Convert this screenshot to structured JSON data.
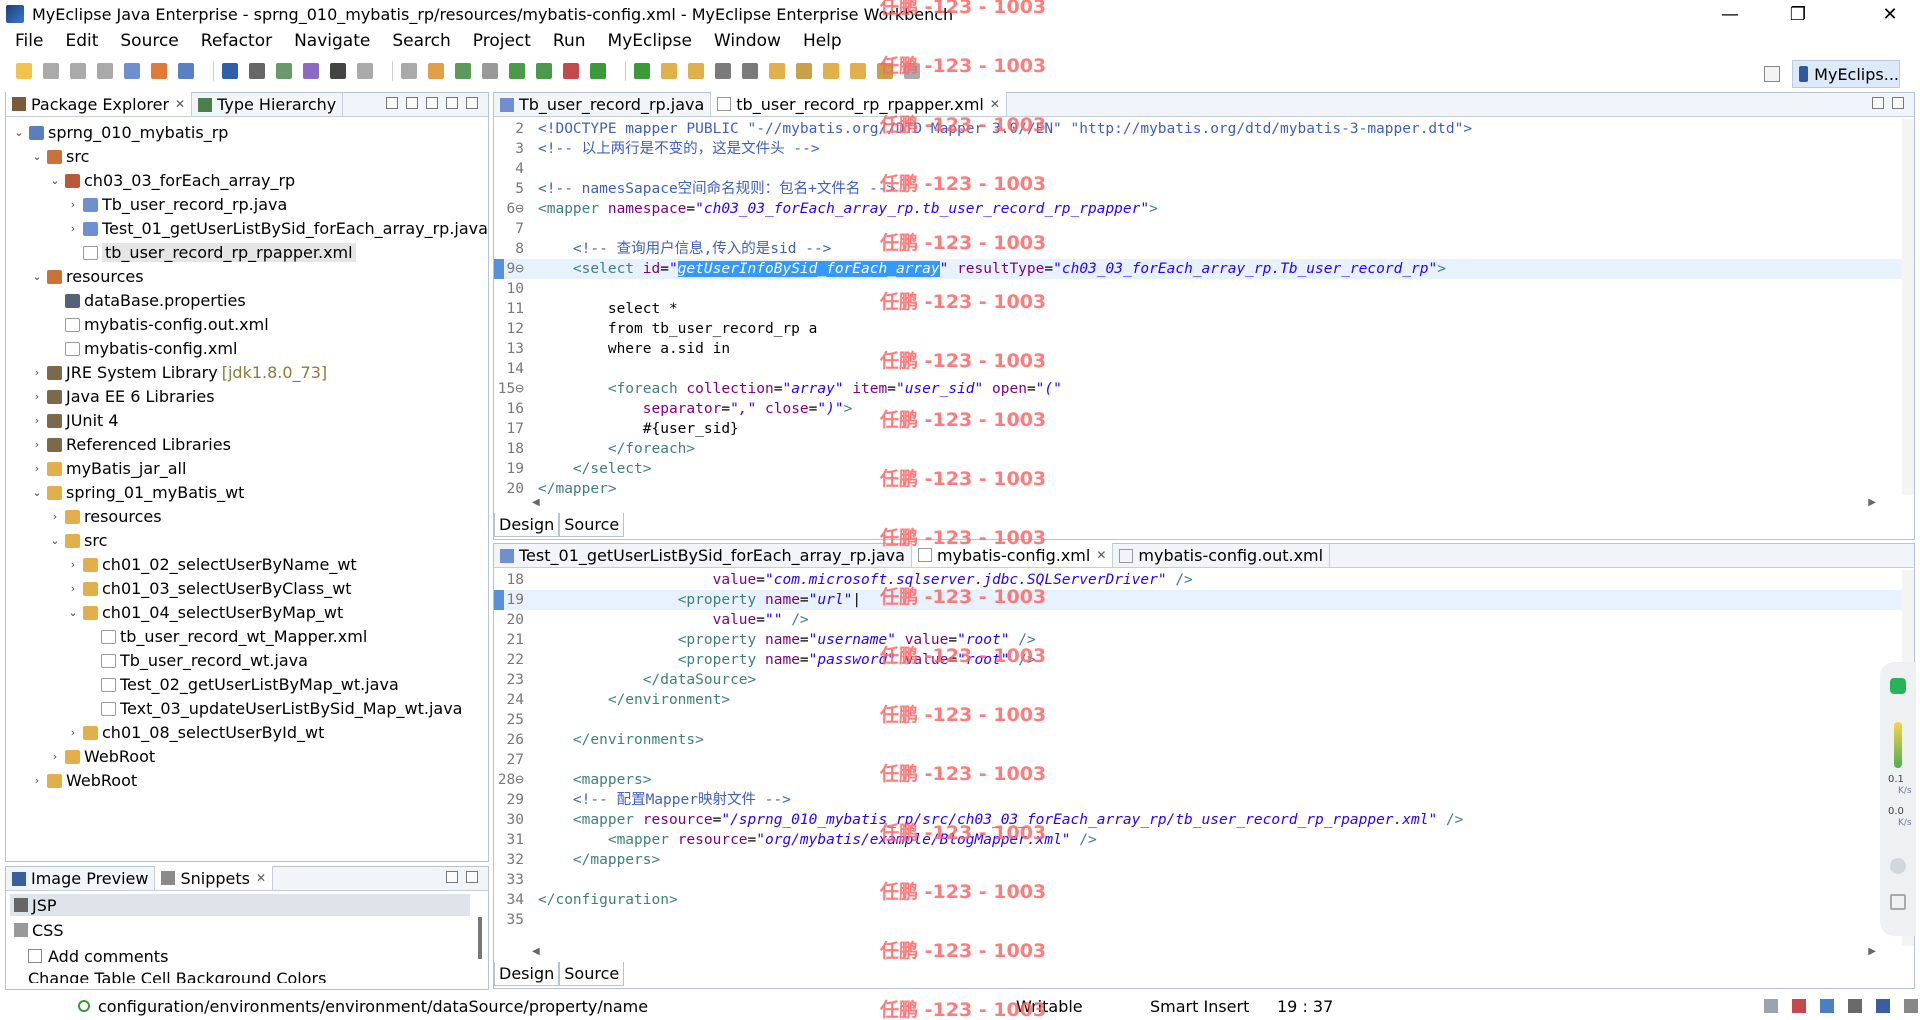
{
  "window": {
    "title": "MyEclipse Java Enterprise - sprng_010_mybatis_rp/resources/mybatis-config.xml - MyEclipse Enterprise Workbench",
    "controls": [
      "—",
      "❐",
      "✕"
    ]
  },
  "menu": [
    "File",
    "Edit",
    "Source",
    "Refactor",
    "Navigate",
    "Search",
    "Project",
    "Run",
    "MyEclipse",
    "Window",
    "Help"
  ],
  "perspective": {
    "label": "MyEclips..."
  },
  "explorer": {
    "tabs": [
      "Package Explorer",
      "Type Hierarchy"
    ],
    "tree": [
      {
        "label": "sprng_010_mybatis_rp",
        "level": 0,
        "arrow": "v",
        "icon": "project",
        "color": "#5b7fb8"
      },
      {
        "label": "src",
        "level": 1,
        "arrow": "v",
        "icon": "srcfolder",
        "color": "#c9733a"
      },
      {
        "label": "ch03_03_forEach_array_rp",
        "level": 2,
        "arrow": "v",
        "icon": "package",
        "color": "#b85a3a"
      },
      {
        "label": "Tb_user_record_rp.java",
        "level": 3,
        "arrow": ">",
        "icon": "java",
        "color": "#6f8fcf"
      },
      {
        "label": "Test_01_getUserListBySid_forEach_array_rp.java",
        "level": 3,
        "arrow": ">",
        "icon": "java",
        "color": "#6f8fcf"
      },
      {
        "label": "tb_user_record_rp_rpapper.xml",
        "level": 3,
        "arrow": "",
        "icon": "xml",
        "color": "#9a9a9a",
        "selected": true
      },
      {
        "label": "resources",
        "level": 1,
        "arrow": "v",
        "icon": "srcfolder",
        "color": "#c9733a"
      },
      {
        "label": "dataBase.properties",
        "level": 2,
        "arrow": "",
        "icon": "props",
        "color": "#55607a"
      },
      {
        "label": "mybatis-config.out.xml",
        "level": 2,
        "arrow": "",
        "icon": "xml",
        "color": "#9a9a9a"
      },
      {
        "label": "mybatis-config.xml",
        "level": 2,
        "arrow": "",
        "icon": "xml",
        "color": "#9a9a9a"
      },
      {
        "label": "JRE System Library",
        "decoration": "[jdk1.8.0_73]",
        "level": 1,
        "arrow": ">",
        "icon": "lib",
        "color": "#7a6a4a"
      },
      {
        "label": "Java EE 6 Libraries",
        "level": 1,
        "arrow": ">",
        "icon": "lib",
        "color": "#7a6a4a"
      },
      {
        "label": "JUnit 4",
        "level": 1,
        "arrow": ">",
        "icon": "lib",
        "color": "#7a6a4a"
      },
      {
        "label": "Referenced Libraries",
        "level": 1,
        "arrow": ">",
        "icon": "lib",
        "color": "#7a6a4a"
      },
      {
        "label": "myBatis_jar_all",
        "level": 1,
        "arrow": ">",
        "icon": "folder",
        "color": "#e2b04a"
      },
      {
        "label": "spring_01_myBatis_wt",
        "level": 1,
        "arrow": "v",
        "icon": "folder",
        "color": "#e2b04a"
      },
      {
        "label": "resources",
        "level": 2,
        "arrow": ">",
        "icon": "folder",
        "color": "#e2b04a"
      },
      {
        "label": "src",
        "level": 2,
        "arrow": "v",
        "icon": "folder",
        "color": "#e2b04a"
      },
      {
        "label": "ch01_02_selectUserByName_wt",
        "level": 3,
        "arrow": ">",
        "icon": "folder",
        "color": "#e2b04a"
      },
      {
        "label": "ch01_03_selectUserByClass_wt",
        "level": 3,
        "arrow": ">",
        "icon": "folder",
        "color": "#e2b04a"
      },
      {
        "label": "ch01_04_selectUserByMap_wt",
        "level": 3,
        "arrow": "v",
        "icon": "folder",
        "color": "#e2b04a"
      },
      {
        "label": "tb_user_record_wt_Mapper.xml",
        "level": 4,
        "arrow": "",
        "icon": "xml",
        "color": "#9a9a9a"
      },
      {
        "label": "Tb_user_record_wt.java",
        "level": 4,
        "arrow": "",
        "icon": "file",
        "color": "#9a9a9a"
      },
      {
        "label": "Test_02_getUserListByMap_wt.java",
        "level": 4,
        "arrow": "",
        "icon": "file",
        "color": "#9a9a9a"
      },
      {
        "label": "Text_03_updateUserListBySid_Map_wt.java",
        "level": 4,
        "arrow": "",
        "icon": "file",
        "color": "#9a9a9a"
      },
      {
        "label": "ch01_08_selectUserById_wt",
        "level": 3,
        "arrow": ">",
        "icon": "folder",
        "color": "#e2b04a"
      },
      {
        "label": "WebRoot",
        "level": 2,
        "arrow": ">",
        "icon": "folder",
        "color": "#e2b04a"
      },
      {
        "label": "WebRoot",
        "level": 1,
        "arrow": ">",
        "icon": "folder",
        "color": "#e2b04a"
      }
    ]
  },
  "snippets": {
    "tabs": [
      "Image Preview",
      "Snippets"
    ],
    "categories": [
      "JSP",
      "CSS"
    ],
    "items": [
      "Add comments",
      "Change Table Cell Background Colors"
    ]
  },
  "editor_top": {
    "tabs": [
      "Tb_user_record_rp.java",
      "tb_user_record_rp_rpapper.xml"
    ],
    "active_tab": 1,
    "bottom_tabs": [
      "Design",
      "Source"
    ],
    "lines": [
      {
        "n": "2",
        "segs": [
          [
            "cm",
            "<!DOCTYPE mapper PUBLIC \"-//mybatis.org//DTD Mapper 3.0//EN\" \"http://mybatis.org/dtd/mybatis-3-mapper.dtd\">"
          ]
        ]
      },
      {
        "n": "3",
        "segs": [
          [
            "cm",
            "<!-- 以上两行是不变的，这是文件头 -->"
          ]
        ]
      },
      {
        "n": "4",
        "segs": []
      },
      {
        "n": "5",
        "segs": [
          [
            "cm",
            "<!-- namesSapace空间命名规则：包名+文件名 -->"
          ]
        ]
      },
      {
        "n": "6⊖",
        "segs": [
          [
            "tag",
            "<mapper "
          ],
          [
            "attr",
            "namespace"
          ],
          [
            "plain",
            "="
          ],
          [
            "val",
            "\"ch03_03_forEach_array_rp.tb_user_record_rp_rpapper\""
          ],
          [
            "tag",
            ">"
          ]
        ]
      },
      {
        "n": "7",
        "segs": []
      },
      {
        "n": "8",
        "segs": [
          [
            "plain",
            "    "
          ],
          [
            "cm",
            "<!-- 查询用户信息,传入的是sid -->"
          ]
        ]
      },
      {
        "n": "9⊖",
        "cur": true,
        "segs": [
          [
            "plain",
            "    "
          ],
          [
            "tag",
            "<select "
          ],
          [
            "attr",
            "id"
          ],
          [
            "plain",
            "="
          ],
          [
            "val",
            "\""
          ],
          [
            "hl",
            "getUserInfoBySid_forEach_array"
          ],
          [
            "val",
            "\""
          ],
          [
            "plain",
            " "
          ],
          [
            "attr",
            "resultType"
          ],
          [
            "plain",
            "="
          ],
          [
            "val",
            "\"ch03_03_forEach_array_rp.Tb_user_record_rp\""
          ],
          [
            "tag",
            ">"
          ]
        ]
      },
      {
        "n": "10",
        "segs": []
      },
      {
        "n": "11",
        "segs": [
          [
            "plain",
            "        select *"
          ]
        ]
      },
      {
        "n": "12",
        "segs": [
          [
            "plain",
            "        from tb_user_record_rp a"
          ]
        ]
      },
      {
        "n": "13",
        "segs": [
          [
            "plain",
            "        where a.sid in"
          ]
        ]
      },
      {
        "n": "14",
        "segs": []
      },
      {
        "n": "15⊖",
        "segs": [
          [
            "plain",
            "        "
          ],
          [
            "tag",
            "<foreach "
          ],
          [
            "attr",
            "collection"
          ],
          [
            "plain",
            "="
          ],
          [
            "val",
            "\"array\""
          ],
          [
            "plain",
            " "
          ],
          [
            "attr",
            "item"
          ],
          [
            "plain",
            "="
          ],
          [
            "val",
            "\"user_sid\""
          ],
          [
            "plain",
            " "
          ],
          [
            "attr",
            "open"
          ],
          [
            "plain",
            "="
          ],
          [
            "val",
            "\"(\""
          ]
        ]
      },
      {
        "n": "16",
        "segs": [
          [
            "plain",
            "            "
          ],
          [
            "attr",
            "separator"
          ],
          [
            "plain",
            "="
          ],
          [
            "val",
            "\",\""
          ],
          [
            "plain",
            " "
          ],
          [
            "attr",
            "close"
          ],
          [
            "plain",
            "="
          ],
          [
            "val",
            "\")\""
          ],
          [
            "tag",
            ">"
          ]
        ]
      },
      {
        "n": "17",
        "segs": [
          [
            "plain",
            "            #{user_sid}"
          ]
        ]
      },
      {
        "n": "18",
        "segs": [
          [
            "plain",
            "        "
          ],
          [
            "tag",
            "</foreach>"
          ]
        ]
      },
      {
        "n": "19",
        "segs": [
          [
            "plain",
            "    "
          ],
          [
            "tag",
            "</select>"
          ]
        ]
      },
      {
        "n": "20",
        "segs": [
          [
            "tag",
            "</mapper>"
          ]
        ]
      }
    ]
  },
  "editor_bottom": {
    "tabs": [
      "Test_01_getUserListBySid_forEach_array_rp.java",
      "mybatis-config.xml",
      "mybatis-config.out.xml"
    ],
    "active_tab": 1,
    "bottom_tabs": [
      "Design",
      "Source"
    ],
    "lines": [
      {
        "n": "18",
        "segs": [
          [
            "plain",
            "                    "
          ],
          [
            "attr",
            "value"
          ],
          [
            "plain",
            "="
          ],
          [
            "val",
            "\"com.microsoft.sqlserver.jdbc.SQLServerDriver\""
          ],
          [
            "plain",
            " "
          ],
          [
            "tag",
            "/>"
          ]
        ]
      },
      {
        "n": "19",
        "cur": true,
        "segs": [
          [
            "plain",
            "                "
          ],
          [
            "tag",
            "<property "
          ],
          [
            "attr",
            "name"
          ],
          [
            "plain",
            "="
          ],
          [
            "val",
            "\"url\""
          ],
          [
            "plain",
            "|"
          ]
        ]
      },
      {
        "n": "20",
        "segs": [
          [
            "plain",
            "                    "
          ],
          [
            "attr",
            "value"
          ],
          [
            "plain",
            "="
          ],
          [
            "val",
            "\"\""
          ],
          [
            "plain",
            " "
          ],
          [
            "tag",
            "/>"
          ]
        ]
      },
      {
        "n": "21",
        "segs": [
          [
            "plain",
            "                "
          ],
          [
            "tag",
            "<property "
          ],
          [
            "attr",
            "name"
          ],
          [
            "plain",
            "="
          ],
          [
            "val",
            "\"username\""
          ],
          [
            "plain",
            " "
          ],
          [
            "attr",
            "value"
          ],
          [
            "plain",
            "="
          ],
          [
            "val",
            "\"root\""
          ],
          [
            "plain",
            " "
          ],
          [
            "tag",
            "/>"
          ]
        ]
      },
      {
        "n": "22",
        "segs": [
          [
            "plain",
            "                "
          ],
          [
            "tag",
            "<property "
          ],
          [
            "attr",
            "name"
          ],
          [
            "plain",
            "="
          ],
          [
            "val",
            "\"password\""
          ],
          [
            "plain",
            " "
          ],
          [
            "attr",
            "value"
          ],
          [
            "plain",
            "="
          ],
          [
            "val",
            "\"root\""
          ],
          [
            "plain",
            " "
          ],
          [
            "tag",
            "/>"
          ]
        ]
      },
      {
        "n": "23",
        "segs": [
          [
            "plain",
            "            "
          ],
          [
            "tag",
            "</dataSource>"
          ]
        ]
      },
      {
        "n": "24",
        "segs": [
          [
            "plain",
            "        "
          ],
          [
            "tag",
            "</environment>"
          ]
        ]
      },
      {
        "n": "25",
        "segs": []
      },
      {
        "n": "26",
        "segs": [
          [
            "plain",
            "    "
          ],
          [
            "tag",
            "</environments>"
          ]
        ]
      },
      {
        "n": "27",
        "segs": []
      },
      {
        "n": "28⊖",
        "segs": [
          [
            "plain",
            "    "
          ],
          [
            "tag",
            "<mappers>"
          ]
        ]
      },
      {
        "n": "29",
        "segs": [
          [
            "plain",
            "    "
          ],
          [
            "cm",
            "<!-- 配置Mapper映射文件 -->"
          ]
        ]
      },
      {
        "n": "30",
        "segs": [
          [
            "plain",
            "    "
          ],
          [
            "tag",
            "<mapper "
          ],
          [
            "attr",
            "resource"
          ],
          [
            "plain",
            "="
          ],
          [
            "val",
            "\"/sprng_010_mybatis_rp/src/ch03_03_forEach_array_rp/tb_user_record_rp_rpapper.xml\""
          ],
          [
            "plain",
            " "
          ],
          [
            "tag",
            "/>"
          ]
        ]
      },
      {
        "n": "31",
        "segs": [
          [
            "plain",
            "        "
          ],
          [
            "tag",
            "<mapper "
          ],
          [
            "attr",
            "resource"
          ],
          [
            "plain",
            "="
          ],
          [
            "val",
            "\"org/mybatis/example/BlogMapper.xml\""
          ],
          [
            "plain",
            " "
          ],
          [
            "tag",
            "/>"
          ]
        ]
      },
      {
        "n": "32",
        "segs": [
          [
            "plain",
            "    "
          ],
          [
            "tag",
            "</mappers>"
          ]
        ]
      },
      {
        "n": "33",
        "segs": []
      },
      {
        "n": "34",
        "segs": [
          [
            "tag",
            "</configuration>"
          ]
        ]
      },
      {
        "n": "35",
        "segs": []
      }
    ]
  },
  "status": {
    "path": "configuration/environments/environment/dataSource/property/name",
    "mode": "Writable",
    "insert": "Smart Insert",
    "position": "19 : 37"
  },
  "side_widget": {
    "up": "0.1",
    "down": "0.0",
    "unit": "K/s"
  },
  "watermark": "任鹏 -123 - 1003"
}
